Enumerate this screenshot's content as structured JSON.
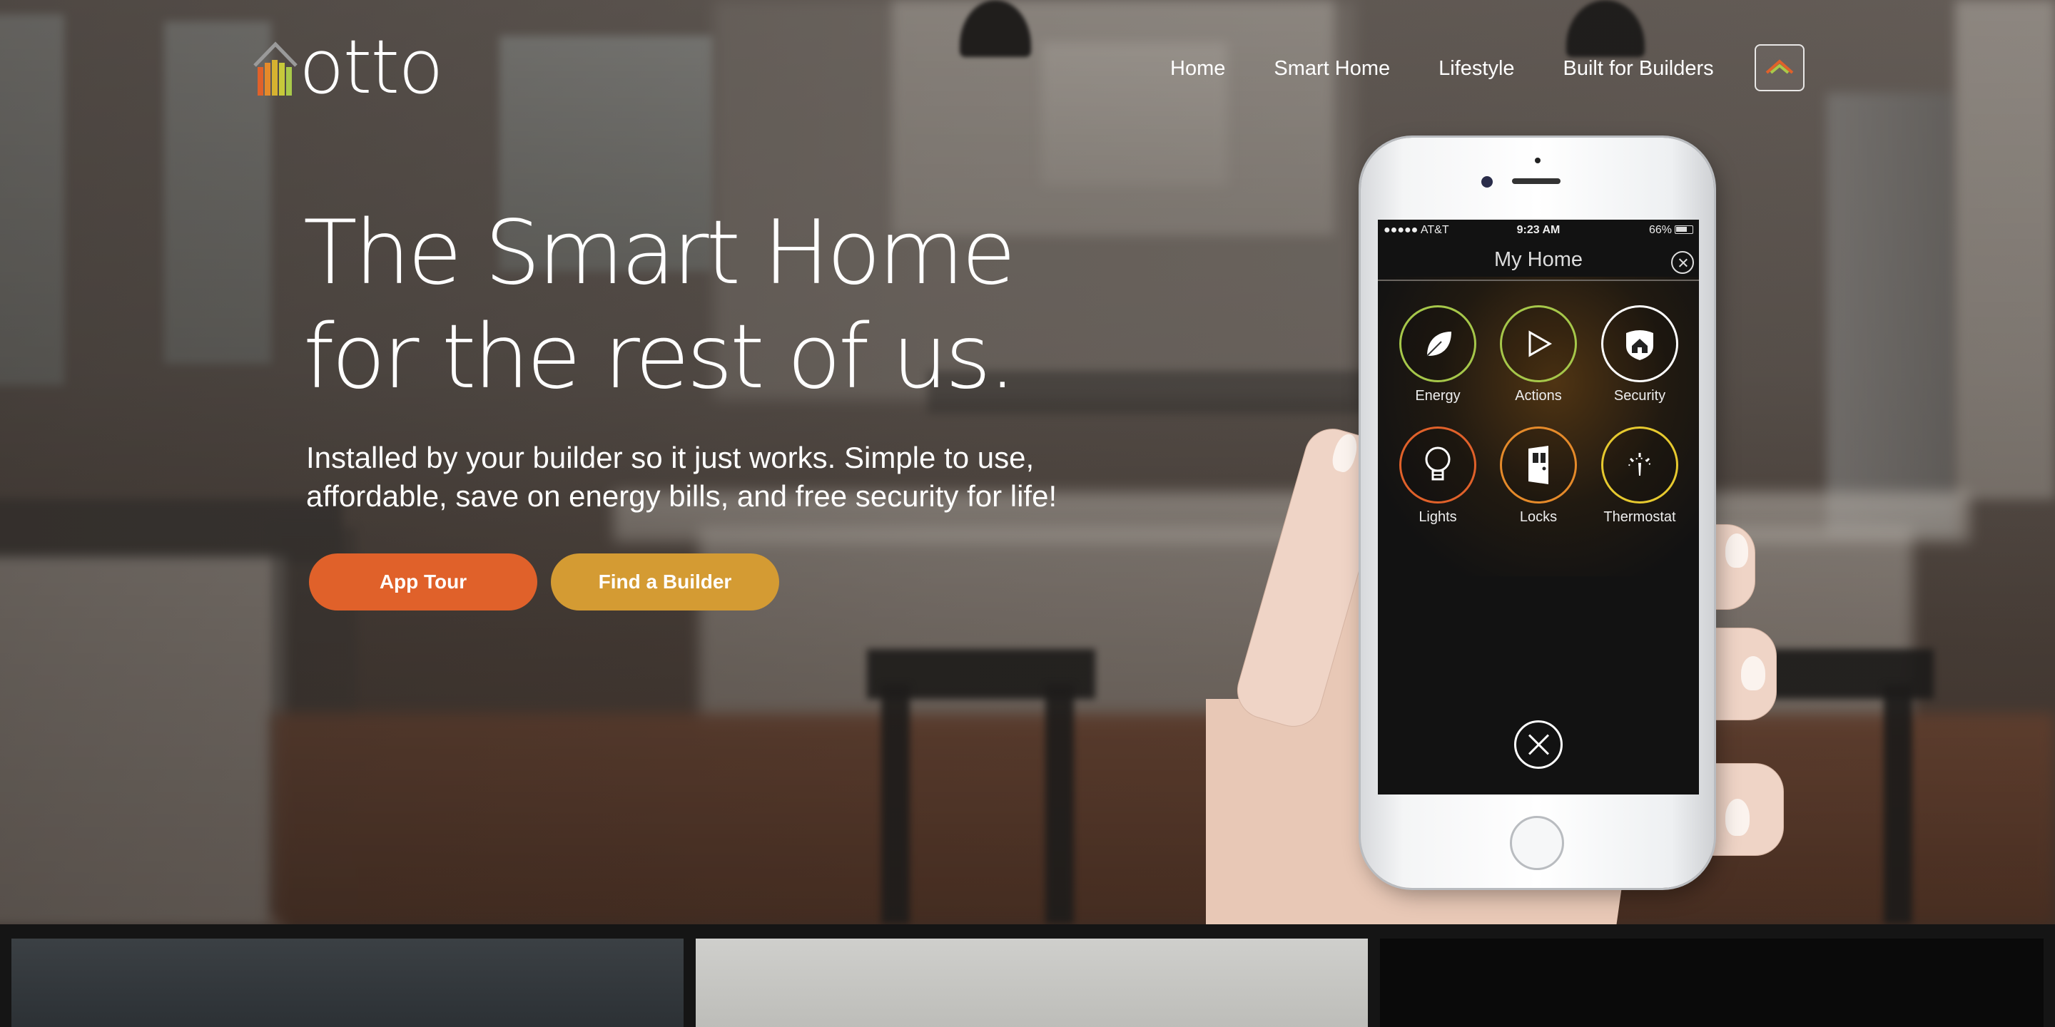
{
  "brand": {
    "name": "otto",
    "logo_colors": [
      "#e0612a",
      "#e58a2a",
      "#d6b230",
      "#c7c93a",
      "#a9c94a"
    ]
  },
  "nav": {
    "items": [
      {
        "label": "Home"
      },
      {
        "label": "Smart Home"
      },
      {
        "label": "Lifestyle"
      },
      {
        "label": "Built for Builders"
      }
    ],
    "home_button_icon": "house-roof-icon"
  },
  "hero": {
    "headline_line1": "The Smart Home",
    "headline_line2": "for the rest of us.",
    "subhead": "Installed by your builder so it just works. Simple to use, affordable, save on energy bills, and free security for life!",
    "buttons": {
      "app_tour": "App Tour",
      "find_builder": "Find a Builder"
    },
    "colors": {
      "app_tour": "#e0612a",
      "find_builder": "#d49b33"
    }
  },
  "phone": {
    "status": {
      "carrier": "●●●●● AT&T",
      "time": "9:23 AM",
      "battery": "66%"
    },
    "screen_title": "My Home",
    "tiles": [
      {
        "label": "Energy",
        "icon": "leaf-icon",
        "color": "#a6c74a"
      },
      {
        "label": "Actions",
        "icon": "play-icon",
        "color": "#a6c74a"
      },
      {
        "label": "Security",
        "icon": "shield-home-icon",
        "color": "#ffffff"
      },
      {
        "label": "Lights",
        "icon": "bulb-icon",
        "color": "#e0612a"
      },
      {
        "label": "Locks",
        "icon": "door-icon",
        "color": "#e58a2a"
      },
      {
        "label": "Thermostat",
        "icon": "thermostat-icon",
        "color": "#e6c92f"
      }
    ]
  }
}
